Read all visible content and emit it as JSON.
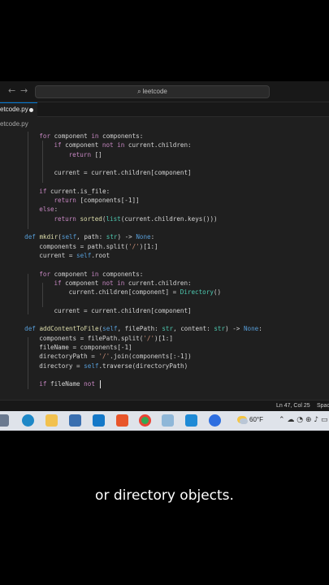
{
  "titlebar": {
    "back_arrow": "←",
    "forward_arrow": "→",
    "search_icon": "search-icon",
    "search_text": "leetcode"
  },
  "tab": {
    "label": "etcode.py",
    "modified_indicator": "●"
  },
  "breadcrumb": "etcode.py",
  "code_lines": [
    {
      "indent": 6,
      "tokens": [
        [
          "kw",
          "for"
        ],
        [
          "plain",
          " component "
        ],
        [
          "kw",
          "in"
        ],
        [
          "plain",
          " components:"
        ]
      ]
    },
    {
      "indent": 9,
      "tokens": [
        [
          "kw",
          "if"
        ],
        [
          "plain",
          " component "
        ],
        [
          "kw",
          "not in"
        ],
        [
          "plain",
          " current.children:"
        ]
      ]
    },
    {
      "indent": 12,
      "tokens": [
        [
          "kw",
          "return"
        ],
        [
          "plain",
          " []"
        ]
      ]
    },
    {
      "indent": 0,
      "tokens": []
    },
    {
      "indent": 9,
      "tokens": [
        [
          "plain",
          "current = current.children[component]"
        ]
      ]
    },
    {
      "indent": 0,
      "tokens": []
    },
    {
      "indent": 6,
      "tokens": [
        [
          "kw",
          "if"
        ],
        [
          "plain",
          " current.is_file:"
        ]
      ]
    },
    {
      "indent": 9,
      "tokens": [
        [
          "kw",
          "return"
        ],
        [
          "plain",
          " [components[-1]]"
        ]
      ]
    },
    {
      "indent": 6,
      "tokens": [
        [
          "kw",
          "else"
        ],
        [
          "plain",
          ":"
        ]
      ]
    },
    {
      "indent": 9,
      "tokens": [
        [
          "kw",
          "return"
        ],
        [
          "plain",
          " "
        ],
        [
          "fn",
          "sorted"
        ],
        [
          "plain",
          "("
        ],
        [
          "cls",
          "list"
        ],
        [
          "plain",
          "(current.children.keys()))"
        ]
      ]
    },
    {
      "indent": 0,
      "tokens": []
    },
    {
      "indent": 3,
      "tokens": [
        [
          "def",
          "def"
        ],
        [
          "plain",
          " "
        ],
        [
          "fn",
          "mkdir"
        ],
        [
          "plain",
          "("
        ],
        [
          "self",
          "self"
        ],
        [
          "plain",
          ", path: "
        ],
        [
          "cls",
          "str"
        ],
        [
          "plain",
          ") -> "
        ],
        [
          "def",
          "None"
        ],
        [
          "plain",
          ":"
        ]
      ]
    },
    {
      "indent": 6,
      "tokens": [
        [
          "plain",
          "components = path.split("
        ],
        [
          "str",
          "'/'"
        ],
        [
          "plain",
          ")[1:]"
        ]
      ]
    },
    {
      "indent": 6,
      "tokens": [
        [
          "plain",
          "current = "
        ],
        [
          "self",
          "self"
        ],
        [
          "plain",
          ".root"
        ]
      ]
    },
    {
      "indent": 0,
      "tokens": []
    },
    {
      "indent": 6,
      "tokens": [
        [
          "kw",
          "for"
        ],
        [
          "plain",
          " component "
        ],
        [
          "kw",
          "in"
        ],
        [
          "plain",
          " components:"
        ]
      ]
    },
    {
      "indent": 9,
      "tokens": [
        [
          "kw",
          "if"
        ],
        [
          "plain",
          " component "
        ],
        [
          "kw",
          "not in"
        ],
        [
          "plain",
          " current.children:"
        ]
      ]
    },
    {
      "indent": 12,
      "tokens": [
        [
          "plain",
          "current.children[component] = "
        ],
        [
          "cls",
          "Directory"
        ],
        [
          "plain",
          "()"
        ]
      ]
    },
    {
      "indent": 0,
      "tokens": []
    },
    {
      "indent": 9,
      "tokens": [
        [
          "plain",
          "current = current.children[component]"
        ]
      ]
    },
    {
      "indent": 0,
      "tokens": []
    },
    {
      "indent": 3,
      "tokens": [
        [
          "def",
          "def"
        ],
        [
          "plain",
          " "
        ],
        [
          "fn",
          "addContentToFile"
        ],
        [
          "plain",
          "("
        ],
        [
          "self",
          "self"
        ],
        [
          "plain",
          ", filePath: "
        ],
        [
          "cls",
          "str"
        ],
        [
          "plain",
          ", content: "
        ],
        [
          "cls",
          "str"
        ],
        [
          "plain",
          ") -> "
        ],
        [
          "def",
          "None"
        ],
        [
          "plain",
          ":"
        ]
      ]
    },
    {
      "indent": 6,
      "tokens": [
        [
          "plain",
          "components = filePath.split("
        ],
        [
          "str",
          "'/'"
        ],
        [
          "plain",
          ")[1:]"
        ]
      ]
    },
    {
      "indent": 6,
      "tokens": [
        [
          "plain",
          "fileName = components[-1]"
        ]
      ]
    },
    {
      "indent": 6,
      "tokens": [
        [
          "plain",
          "directoryPath = "
        ],
        [
          "str",
          "'/'"
        ],
        [
          "plain",
          ".join(components[:-1])"
        ]
      ]
    },
    {
      "indent": 6,
      "tokens": [
        [
          "plain",
          "directory = "
        ],
        [
          "self",
          "self"
        ],
        [
          "plain",
          ".traverse(directoryPath)"
        ]
      ]
    },
    {
      "indent": 0,
      "tokens": []
    },
    {
      "indent": 6,
      "tokens": [
        [
          "kw",
          "if"
        ],
        [
          "plain",
          " fileName "
        ],
        [
          "kw",
          "not"
        ],
        [
          "plain",
          " "
        ]
      ]
    }
  ],
  "status": {
    "position": "Ln 47, Col 25",
    "spaces": "Spac"
  },
  "taskbar": {
    "temperature": "60°F",
    "tray_glyphs": "⌃ ☁ ◔ ⊕ ♪ ▭"
  },
  "caption": "or directory objects."
}
